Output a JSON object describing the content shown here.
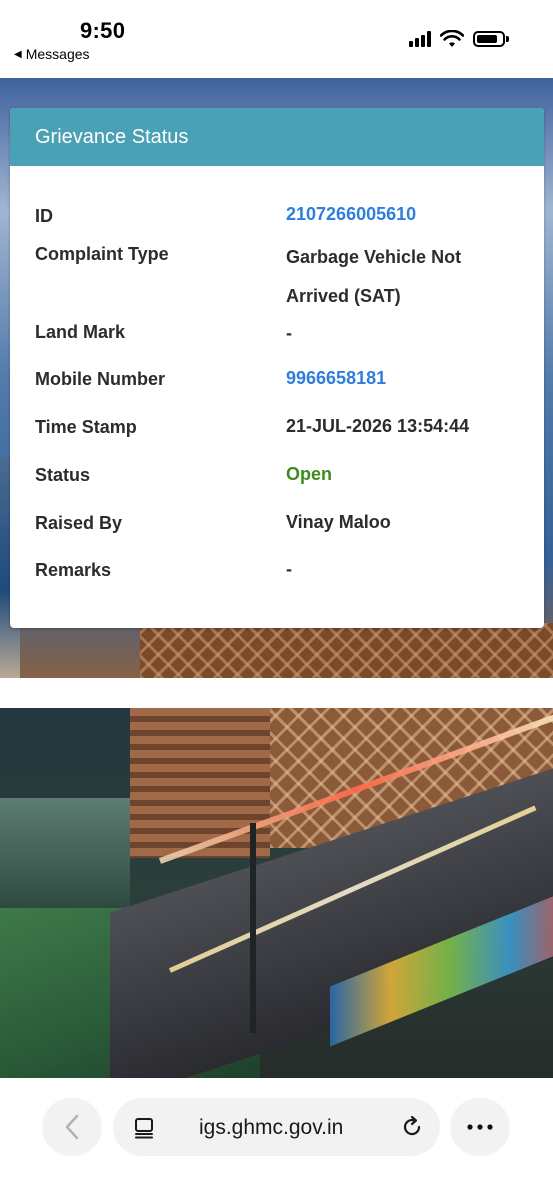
{
  "status_bar": {
    "time": "9:50",
    "back_app": "Messages"
  },
  "card": {
    "title": "Grievance Status",
    "rows": [
      {
        "label": "ID",
        "value": "2107266005610"
      },
      {
        "label": "Complaint Type",
        "value_line1": "Garbage Vehicle Not",
        "value_line2": "Arrived (SAT)"
      },
      {
        "label": "Land Mark",
        "value": "-"
      },
      {
        "label": "Mobile Number",
        "value": "9966658181"
      },
      {
        "label": "Time Stamp",
        "value": "21-JUL-2026 13:54:44"
      },
      {
        "label": "Status",
        "value": "Open"
      },
      {
        "label": "Raised By",
        "value": "Vinay Maloo"
      },
      {
        "label": "Remarks",
        "value": "-"
      }
    ]
  },
  "browser": {
    "url": "igs.ghmc.gov.in",
    "back_icon": "chevron-left-icon",
    "tabs_icon": "tabs-icon",
    "reload_icon": "reload-icon",
    "more_icon": "more-icon"
  },
  "colors": {
    "header": "#4aa0b4",
    "link": "#2f7ddc",
    "status_open": "#3d8a1f"
  }
}
